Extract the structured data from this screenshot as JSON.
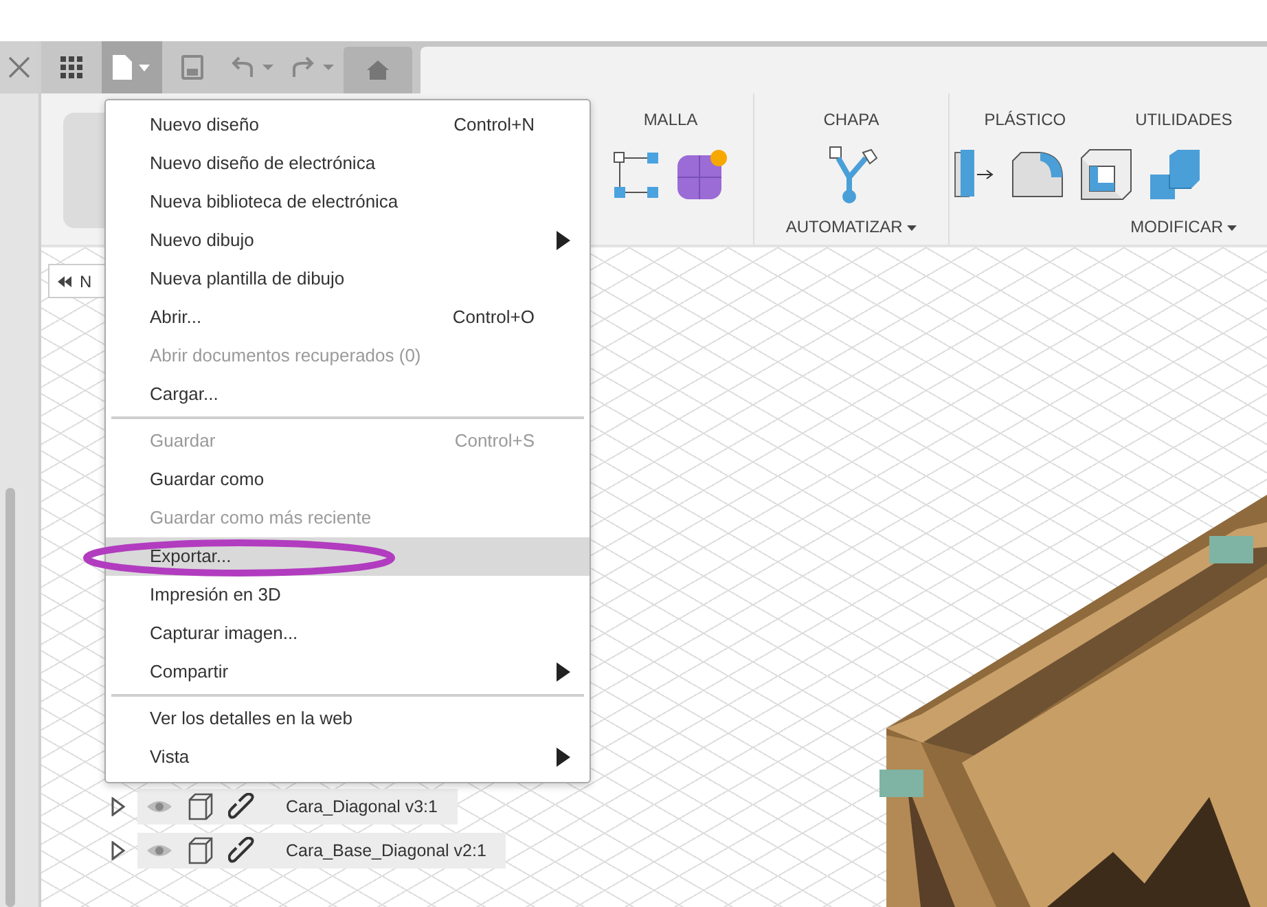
{
  "toolbar": {
    "file_menu_open": true
  },
  "ribbon": {
    "columns": [
      {
        "tabs": [
          "MALLA"
        ]
      },
      {
        "tabs": [
          "CHAPA"
        ],
        "group": "AUTOMATIZAR"
      },
      {
        "tabs": [
          "PLÁSTICO",
          "UTILIDADES"
        ],
        "group": "MODIFICAR"
      }
    ]
  },
  "browser": {
    "header": "N",
    "items": [
      {
        "name": "Cara_Diagonal v3:1",
        "expanded": false
      },
      {
        "name": "Cara_Base_Diagonal v2:1",
        "expanded": false
      }
    ]
  },
  "file_menu": {
    "items": [
      {
        "kind": "item",
        "label": "Nuevo diseño",
        "shortcut": "Control+N",
        "disabled": false,
        "submenu": false,
        "selected": false
      },
      {
        "kind": "item",
        "label": "Nuevo diseño de electrónica",
        "disabled": false,
        "submenu": false,
        "selected": false
      },
      {
        "kind": "item",
        "label": "Nueva biblioteca de electrónica",
        "disabled": false,
        "submenu": false,
        "selected": false
      },
      {
        "kind": "item",
        "label": "Nuevo dibujo",
        "disabled": false,
        "submenu": true,
        "selected": false
      },
      {
        "kind": "item",
        "label": "Nueva plantilla de dibujo",
        "disabled": false,
        "submenu": false,
        "selected": false
      },
      {
        "kind": "item",
        "label": "Abrir...",
        "shortcut": "Control+O",
        "disabled": false,
        "submenu": false,
        "selected": false
      },
      {
        "kind": "item",
        "label": "Abrir documentos recuperados (0)",
        "disabled": true,
        "submenu": false,
        "selected": false
      },
      {
        "kind": "item",
        "label": "Cargar...",
        "disabled": false,
        "submenu": false,
        "selected": false
      },
      {
        "kind": "separator"
      },
      {
        "kind": "item",
        "label": "Guardar",
        "shortcut": "Control+S",
        "disabled": true,
        "submenu": false,
        "selected": false
      },
      {
        "kind": "item",
        "label": "Guardar como",
        "disabled": false,
        "submenu": false,
        "selected": false
      },
      {
        "kind": "item",
        "label": "Guardar como más reciente",
        "disabled": true,
        "submenu": false,
        "selected": false
      },
      {
        "kind": "item",
        "label": "Exportar...",
        "disabled": false,
        "submenu": false,
        "selected": true
      },
      {
        "kind": "item",
        "label": "Impresión en 3D",
        "disabled": false,
        "submenu": false,
        "selected": false
      },
      {
        "kind": "item",
        "label": "Capturar imagen...",
        "disabled": false,
        "submenu": false,
        "selected": false
      },
      {
        "kind": "item",
        "label": "Compartir",
        "disabled": false,
        "submenu": true,
        "selected": false
      },
      {
        "kind": "separator"
      },
      {
        "kind": "item",
        "label": "Ver los detalles en la web",
        "disabled": false,
        "submenu": false,
        "selected": false
      },
      {
        "kind": "item",
        "label": "Vista",
        "disabled": false,
        "submenu": true,
        "selected": false
      }
    ]
  },
  "annotation": {
    "kind": "ellipse",
    "color": "#b23cbf"
  }
}
